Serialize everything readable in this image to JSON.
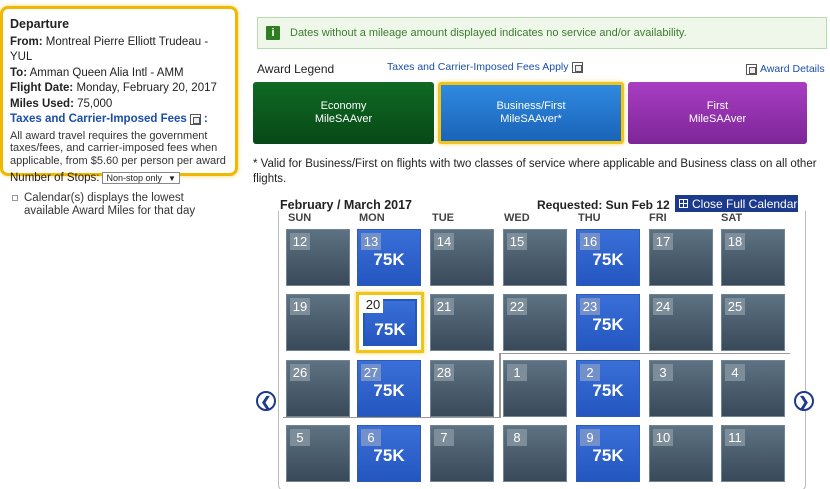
{
  "departure": {
    "title": "Departure",
    "from_label": "From:",
    "from_value": "Montreal Pierre Elliott Trudeau - YUL",
    "to_label": "To:",
    "to_value": "Amman Queen Alia Intl - AMM",
    "date_label": "Flight Date:",
    "date_value": "Monday, February 20, 2017",
    "miles_label": "Miles Used:",
    "miles_value": "75,000",
    "fees_link": "Taxes and Carrier-Imposed Fees",
    "fees_colon": ":",
    "fees_text": "All award travel requires the government taxes/fees, and carrier-imposed fees when applicable, from $5.60 per person per award"
  },
  "stops": {
    "label": "Number of Stops:",
    "value": "Non-stop only"
  },
  "calendar_note": "Calendar(s) displays the lowest available Award Miles for that day",
  "info_bar": "Dates without a mileage amount displayed indicates no service and/or availability.",
  "legend": {
    "label": "Award Legend",
    "fees_link": "Taxes and Carrier-Imposed Fees Apply",
    "award_details": "Award Details",
    "buttons": [
      {
        "line1": "Economy",
        "line2": "MileSAAver"
      },
      {
        "line1": "Business/First",
        "line2": "MileSAAver*"
      },
      {
        "line1": "First",
        "line2": "MileSAAver"
      }
    ]
  },
  "valid_note": "* Valid for Business/First on flights with two classes of service where applicable and Business class on all other flights.",
  "calendar": {
    "month": "February / March 2017",
    "requested": "Requested: Sun Feb 12",
    "close_button": "Close Full Calendar",
    "day_headers": [
      "SUN",
      "MON",
      "TUE",
      "WED",
      "THU",
      "FRI",
      "SAT"
    ],
    "weeks": [
      [
        {
          "d": "12",
          "m": ""
        },
        {
          "d": "13",
          "m": "75K"
        },
        {
          "d": "14",
          "m": ""
        },
        {
          "d": "15",
          "m": ""
        },
        {
          "d": "16",
          "m": "75K"
        },
        {
          "d": "17",
          "m": ""
        },
        {
          "d": "18",
          "m": ""
        }
      ],
      [
        {
          "d": "19",
          "m": ""
        },
        {
          "d": "20",
          "m": "75K",
          "selected": true
        },
        {
          "d": "21",
          "m": ""
        },
        {
          "d": "22",
          "m": ""
        },
        {
          "d": "23",
          "m": "75K"
        },
        {
          "d": "24",
          "m": ""
        },
        {
          "d": "25",
          "m": ""
        }
      ],
      [
        {
          "d": "26",
          "m": ""
        },
        {
          "d": "27",
          "m": "75K"
        },
        {
          "d": "28",
          "m": ""
        },
        {
          "d": "1",
          "m": ""
        },
        {
          "d": "2",
          "m": "75K"
        },
        {
          "d": "3",
          "m": ""
        },
        {
          "d": "4",
          "m": ""
        }
      ],
      [
        {
          "d": "5",
          "m": ""
        },
        {
          "d": "6",
          "m": "75K"
        },
        {
          "d": "7",
          "m": ""
        },
        {
          "d": "8",
          "m": ""
        },
        {
          "d": "9",
          "m": "75K"
        },
        {
          "d": "10",
          "m": ""
        },
        {
          "d": "11",
          "m": ""
        }
      ]
    ],
    "prev_icon": "chevron-left-icon",
    "next_icon": "chevron-right-icon"
  }
}
